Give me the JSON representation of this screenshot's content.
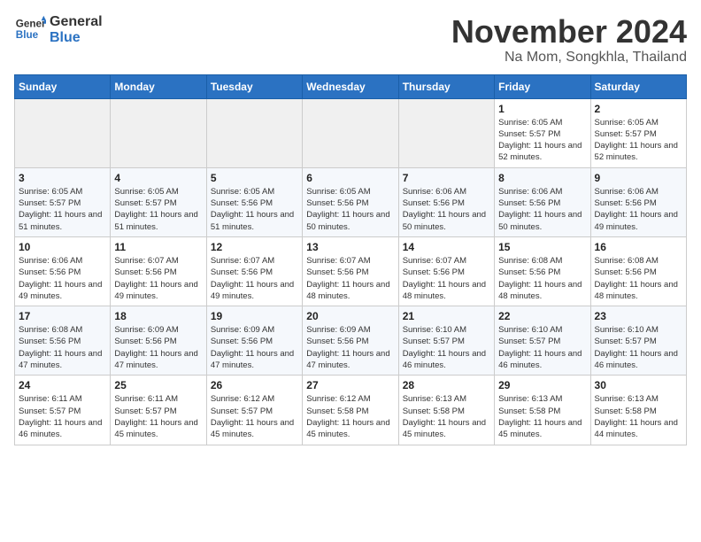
{
  "header": {
    "logo_general": "General",
    "logo_blue": "Blue",
    "month_title": "November 2024",
    "location": "Na Mom, Songkhla, Thailand"
  },
  "days_of_week": [
    "Sunday",
    "Monday",
    "Tuesday",
    "Wednesday",
    "Thursday",
    "Friday",
    "Saturday"
  ],
  "weeks": [
    [
      {
        "day": "",
        "info": ""
      },
      {
        "day": "",
        "info": ""
      },
      {
        "day": "",
        "info": ""
      },
      {
        "day": "",
        "info": ""
      },
      {
        "day": "",
        "info": ""
      },
      {
        "day": "1",
        "info": "Sunrise: 6:05 AM\nSunset: 5:57 PM\nDaylight: 11 hours and 52 minutes."
      },
      {
        "day": "2",
        "info": "Sunrise: 6:05 AM\nSunset: 5:57 PM\nDaylight: 11 hours and 52 minutes."
      }
    ],
    [
      {
        "day": "3",
        "info": "Sunrise: 6:05 AM\nSunset: 5:57 PM\nDaylight: 11 hours and 51 minutes."
      },
      {
        "day": "4",
        "info": "Sunrise: 6:05 AM\nSunset: 5:57 PM\nDaylight: 11 hours and 51 minutes."
      },
      {
        "day": "5",
        "info": "Sunrise: 6:05 AM\nSunset: 5:56 PM\nDaylight: 11 hours and 51 minutes."
      },
      {
        "day": "6",
        "info": "Sunrise: 6:05 AM\nSunset: 5:56 PM\nDaylight: 11 hours and 50 minutes."
      },
      {
        "day": "7",
        "info": "Sunrise: 6:06 AM\nSunset: 5:56 PM\nDaylight: 11 hours and 50 minutes."
      },
      {
        "day": "8",
        "info": "Sunrise: 6:06 AM\nSunset: 5:56 PM\nDaylight: 11 hours and 50 minutes."
      },
      {
        "day": "9",
        "info": "Sunrise: 6:06 AM\nSunset: 5:56 PM\nDaylight: 11 hours and 49 minutes."
      }
    ],
    [
      {
        "day": "10",
        "info": "Sunrise: 6:06 AM\nSunset: 5:56 PM\nDaylight: 11 hours and 49 minutes."
      },
      {
        "day": "11",
        "info": "Sunrise: 6:07 AM\nSunset: 5:56 PM\nDaylight: 11 hours and 49 minutes."
      },
      {
        "day": "12",
        "info": "Sunrise: 6:07 AM\nSunset: 5:56 PM\nDaylight: 11 hours and 49 minutes."
      },
      {
        "day": "13",
        "info": "Sunrise: 6:07 AM\nSunset: 5:56 PM\nDaylight: 11 hours and 48 minutes."
      },
      {
        "day": "14",
        "info": "Sunrise: 6:07 AM\nSunset: 5:56 PM\nDaylight: 11 hours and 48 minutes."
      },
      {
        "day": "15",
        "info": "Sunrise: 6:08 AM\nSunset: 5:56 PM\nDaylight: 11 hours and 48 minutes."
      },
      {
        "day": "16",
        "info": "Sunrise: 6:08 AM\nSunset: 5:56 PM\nDaylight: 11 hours and 48 minutes."
      }
    ],
    [
      {
        "day": "17",
        "info": "Sunrise: 6:08 AM\nSunset: 5:56 PM\nDaylight: 11 hours and 47 minutes."
      },
      {
        "day": "18",
        "info": "Sunrise: 6:09 AM\nSunset: 5:56 PM\nDaylight: 11 hours and 47 minutes."
      },
      {
        "day": "19",
        "info": "Sunrise: 6:09 AM\nSunset: 5:56 PM\nDaylight: 11 hours and 47 minutes."
      },
      {
        "day": "20",
        "info": "Sunrise: 6:09 AM\nSunset: 5:56 PM\nDaylight: 11 hours and 47 minutes."
      },
      {
        "day": "21",
        "info": "Sunrise: 6:10 AM\nSunset: 5:57 PM\nDaylight: 11 hours and 46 minutes."
      },
      {
        "day": "22",
        "info": "Sunrise: 6:10 AM\nSunset: 5:57 PM\nDaylight: 11 hours and 46 minutes."
      },
      {
        "day": "23",
        "info": "Sunrise: 6:10 AM\nSunset: 5:57 PM\nDaylight: 11 hours and 46 minutes."
      }
    ],
    [
      {
        "day": "24",
        "info": "Sunrise: 6:11 AM\nSunset: 5:57 PM\nDaylight: 11 hours and 46 minutes."
      },
      {
        "day": "25",
        "info": "Sunrise: 6:11 AM\nSunset: 5:57 PM\nDaylight: 11 hours and 45 minutes."
      },
      {
        "day": "26",
        "info": "Sunrise: 6:12 AM\nSunset: 5:57 PM\nDaylight: 11 hours and 45 minutes."
      },
      {
        "day": "27",
        "info": "Sunrise: 6:12 AM\nSunset: 5:58 PM\nDaylight: 11 hours and 45 minutes."
      },
      {
        "day": "28",
        "info": "Sunrise: 6:13 AM\nSunset: 5:58 PM\nDaylight: 11 hours and 45 minutes."
      },
      {
        "day": "29",
        "info": "Sunrise: 6:13 AM\nSunset: 5:58 PM\nDaylight: 11 hours and 45 minutes."
      },
      {
        "day": "30",
        "info": "Sunrise: 6:13 AM\nSunset: 5:58 PM\nDaylight: 11 hours and 44 minutes."
      }
    ]
  ]
}
